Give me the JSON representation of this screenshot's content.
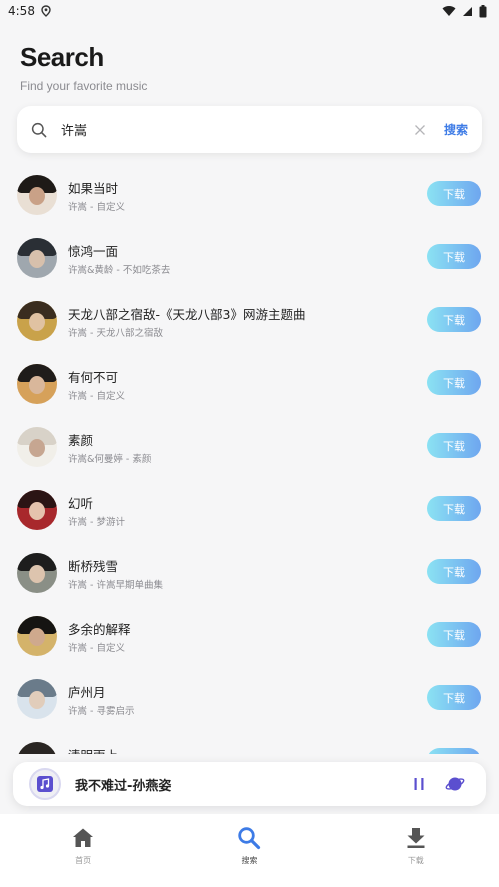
{
  "status_bar": {
    "time": "4:58"
  },
  "header": {
    "title": "Search",
    "subtitle": "Find your favorite music"
  },
  "search": {
    "value": "许嵩",
    "button_label": "搜索"
  },
  "results": [
    {
      "title": "如果当时",
      "subtitle": "许嵩 - 自定义",
      "action": "下载"
    },
    {
      "title": "惊鸿一面",
      "subtitle": "许嵩&黄龄 - 不如吃茶去",
      "action": "下载"
    },
    {
      "title": "天龙八部之宿敌-《天龙八部3》网游主题曲",
      "subtitle": "许嵩 - 天龙八部之宿敌",
      "action": "下载"
    },
    {
      "title": "有何不可",
      "subtitle": "许嵩 - 自定义",
      "action": "下载"
    },
    {
      "title": "素颜",
      "subtitle": "许嵩&何曼婷 - 素颜",
      "action": "下载"
    },
    {
      "title": "幻听",
      "subtitle": "许嵩 - 梦游计",
      "action": "下载"
    },
    {
      "title": "断桥残雪",
      "subtitle": "许嵩 - 许嵩早期单曲集",
      "action": "下载"
    },
    {
      "title": "多余的解释",
      "subtitle": "许嵩 - 自定义",
      "action": "下载"
    },
    {
      "title": "庐州月",
      "subtitle": "许嵩 - 寻雾启示",
      "action": "下载"
    },
    {
      "title": "清明雨上",
      "subtitle": "",
      "action": "下载"
    }
  ],
  "player": {
    "now_playing": "我不难过-孙燕姿"
  },
  "nav": [
    {
      "label": "首页",
      "icon": "home-icon",
      "active": false
    },
    {
      "label": "搜索",
      "icon": "search-icon",
      "active": true
    },
    {
      "label": "下载",
      "icon": "download-icon",
      "active": false
    }
  ],
  "colors": {
    "accent": "#3d7be6",
    "download_gradient_start": "#8be2f3",
    "download_gradient_end": "#6ea6ef",
    "background": "#f6f6f7",
    "player_icon": "#5b4fcf"
  }
}
